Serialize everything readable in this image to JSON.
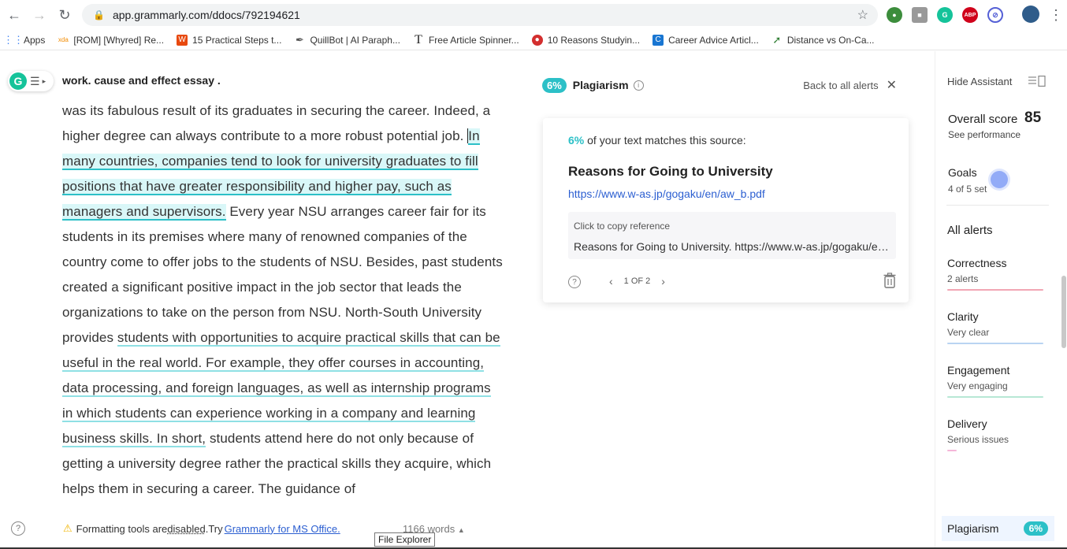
{
  "browser": {
    "url": "app.grammarly.com/ddocs/792194621",
    "bookmarks": [
      {
        "label": "Apps",
        "icon": "apps-grid-icon",
        "color": "#4285f4"
      },
      {
        "label": "[ROM] [Whyred] Re...",
        "icon": "xda-icon",
        "color": "#f28b00"
      },
      {
        "label": "15 Practical Steps t...",
        "icon": "wattpad-icon",
        "color": "#e8490f"
      },
      {
        "label": "QuillBot | AI Paraph...",
        "icon": "feather-icon",
        "color": "#555555"
      },
      {
        "label": "Free Article Spinner...",
        "icon": "t-icon",
        "color": "#222222"
      },
      {
        "label": "10 Reasons Studyin...",
        "icon": "shield-icon",
        "color": "#d32f2f"
      },
      {
        "label": "Career Advice Articl...",
        "icon": "c-icon",
        "color": "#1976d2"
      },
      {
        "label": "Distance vs On-Ca...",
        "icon": "leaf-icon",
        "color": "#2e7d32"
      }
    ]
  },
  "document": {
    "title": "work. cause and effect essay .",
    "text": {
      "p1": "was its fabulous result of its graduates in securing the career. Indeed, a higher degree can always contribute to a more robust potential job. ",
      "highlight": "In many countries, companies tend to look for university graduates to fill positions that have greater responsibility and higher pay, such as managers and supervisors.",
      "p2": " Every year NSU arranges career fair for its students in its premises where many of renowned companies of the country come to offer jobs to the students of NSU. Besides, past students created a significant positive impact in the job sector that leads the organizations to take on the person from NSU.  North-South University provides ",
      "underlined1": "students with opportunities to acquire practical skills that can be useful in the real world. For example, they offer courses in accounting, data processing, and foreign languages, as well as internship programs in which students can experience working in a company and learning business skills. In short,",
      "p3": " students attend here do not only because of getting a university degree rather the practical skills they acquire, which helps them in securing a career. The guidance of"
    }
  },
  "plagiarism": {
    "badge": "6%",
    "title": "Plagiarism",
    "back_label": "Back to all alerts",
    "match_pct": "6%",
    "match_text": " of your text matches this source:",
    "source_title": "Reasons for Going to University",
    "source_url": "https://www.w-as.jp/gogaku/en/aw_b.pdf",
    "copy_label": "Click to copy reference",
    "reference": "Reasons for Going to University. https://www.w-as.jp/gogaku/en/aw_b.pdf",
    "pager": "1 OF 2"
  },
  "sidebar": {
    "hide_label": "Hide Assistant",
    "score_label": "Overall score",
    "score_value": "85",
    "see_performance": "See performance",
    "goals_label": "Goals",
    "goals_sub": "4 of 5 set",
    "all_alerts": "All alerts",
    "categories": [
      {
        "name": "Correctness",
        "sub": "2 alerts",
        "color": "#f2a6b4"
      },
      {
        "name": "Clarity",
        "sub": "Very clear",
        "color": "#b9d4f2"
      },
      {
        "name": "Engagement",
        "sub": "Very engaging",
        "color": "#b7e8d5"
      },
      {
        "name": "Delivery",
        "sub": "Serious issues",
        "color": "#f5b6d9"
      }
    ],
    "plag_tab_label": "Plagiarism",
    "plag_tab_pct": "6%"
  },
  "footer": {
    "format_msg": "Formatting tools are ",
    "disabled": "disabled",
    "try": ".Try ",
    "link": "Grammarly for MS Office.",
    "word_count": "1166 words",
    "tooltip": "File Explorer"
  }
}
